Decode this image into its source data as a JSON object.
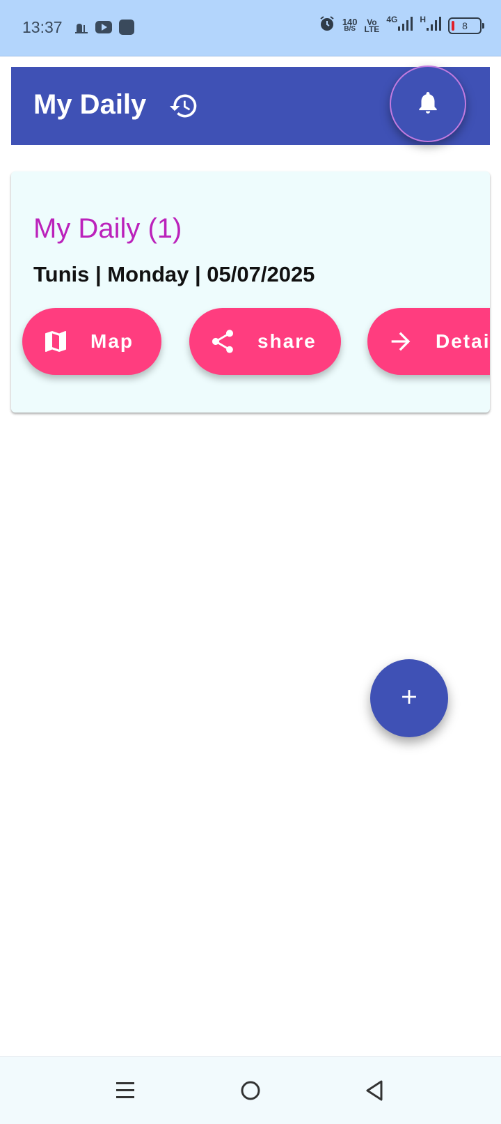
{
  "status_bar": {
    "time": "13:37",
    "net_speed_value": "140",
    "net_speed_unit": "B/S",
    "volte_top": "Vo",
    "volte_bottom": "LTE",
    "network_type": "4G",
    "network_type_2": "H",
    "battery_level": "8",
    "icons": [
      "mosque-icon",
      "youtube-icon",
      "app-icon",
      "alarm-icon",
      "signal-icon",
      "signal-icon",
      "battery-icon"
    ]
  },
  "app_bar": {
    "title": "My Daily",
    "icons": [
      "history-icon",
      "bell-icon"
    ]
  },
  "card": {
    "title": "My Daily (1)",
    "subtitle": "Tunis | Monday | 05/07/2025",
    "buttons": [
      {
        "label": "Map",
        "icon": "map-icon"
      },
      {
        "label": "share",
        "icon": "share-icon"
      },
      {
        "label": "Details",
        "icon": "arrow-right-icon"
      }
    ]
  },
  "fab": {
    "icon": "plus-icon"
  },
  "nav_bar": {
    "icons": [
      "menu-icon",
      "home-icon",
      "back-icon"
    ]
  },
  "colors": {
    "status_bar": "#b3d5fc",
    "primary": "#3f51b5",
    "accent": "#ff3d7f",
    "card_title": "#bb22bb",
    "card_bg": "#eefcfd"
  }
}
